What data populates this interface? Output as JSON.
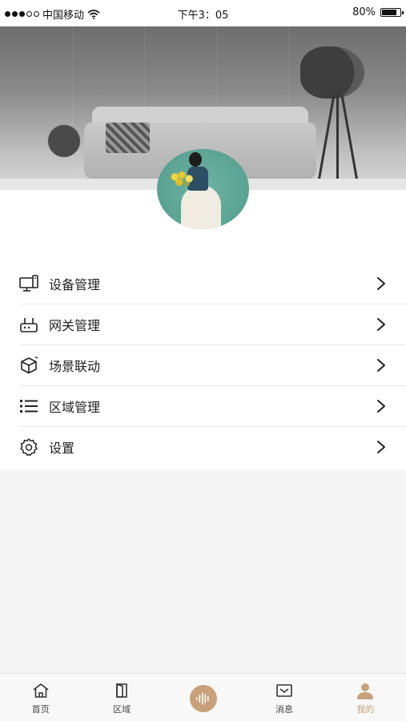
{
  "status_bar": {
    "carrier": "中国移动",
    "time": "下午3：05",
    "battery": "80%",
    "battery_level": 0.8
  },
  "menu": [
    {
      "label": "设备管理",
      "icon": "device-icon"
    },
    {
      "label": "网关管理",
      "icon": "gateway-icon"
    },
    {
      "label": "场景联动",
      "icon": "cube-icon"
    },
    {
      "label": "区域管理",
      "icon": "list-icon"
    },
    {
      "label": "设置",
      "icon": "gear-icon"
    }
  ],
  "tabbar": {
    "items": [
      {
        "label": "首页",
        "icon": "home-icon"
      },
      {
        "label": "区域",
        "icon": "door-icon"
      },
      {
        "label": "",
        "icon": "voice-icon"
      },
      {
        "label": "消息",
        "icon": "mail-icon"
      },
      {
        "label": "我的",
        "icon": "user-icon"
      }
    ],
    "active_index": 4
  },
  "colors": {
    "accent": "#c8a07a",
    "text": "#222222",
    "background": "#f5f5f5"
  }
}
